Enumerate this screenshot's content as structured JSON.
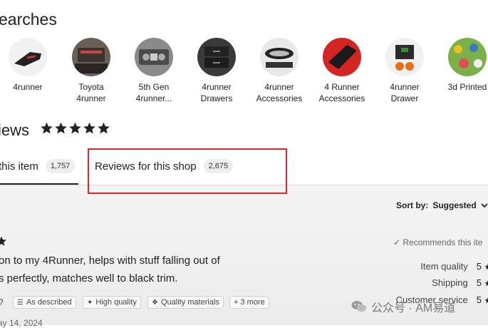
{
  "searches": {
    "title": "earches",
    "items": [
      {
        "label": "4runner"
      },
      {
        "label": "Toyota\n4runner"
      },
      {
        "label": "5th Gen\n4runner..."
      },
      {
        "label": "4runner\nDrawers"
      },
      {
        "label": "4runner\nAccessories"
      },
      {
        "label": "4 Runner\nAccessories"
      },
      {
        "label": "4runner\nDrawer"
      },
      {
        "label": "3d Printed"
      }
    ]
  },
  "reviews": {
    "heading": "iews",
    "tabs": [
      {
        "label": "this item",
        "count": "1,757"
      },
      {
        "label": "Reviews for this shop",
        "count": "2,675"
      }
    ],
    "sort": {
      "label": "Sort by:",
      "value": "Suggested"
    },
    "recommends": "Recommends this ite",
    "text_lines": [
      "on to my 4Runner, helps with stuff falling out of",
      "s perfectly, matches well to black trim."
    ],
    "ratings": [
      {
        "label": "Item quality",
        "value": "5"
      },
      {
        "label": "Shipping",
        "value": "5"
      },
      {
        "label": "Customer service",
        "value": "5"
      }
    ],
    "question_mark": "?",
    "chips": [
      {
        "label": "As described",
        "icon": "checklist-icon"
      },
      {
        "label": "High quality",
        "icon": "sparkle-icon"
      },
      {
        "label": "Quality materials",
        "icon": "fabric-icon"
      },
      {
        "label": "+ 3 more",
        "icon": ""
      }
    ],
    "date": "ay 14, 2024"
  },
  "watermark": {
    "text": "公众号 · AM易道"
  },
  "colors": {
    "highlight": "#e0262a",
    "star": "#222222"
  }
}
